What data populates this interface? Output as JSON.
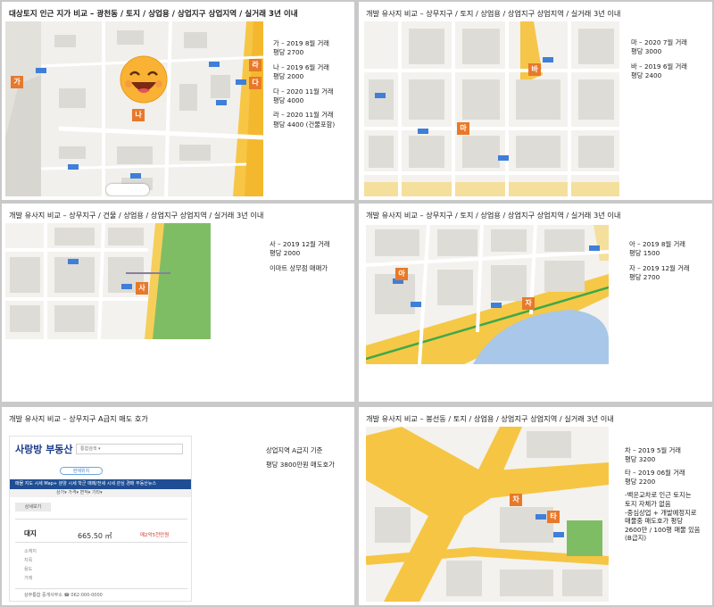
{
  "slides": [
    {
      "title": "대상토지 인근 지가 비교 – 광천동 / 토지 / 상업용 / 상업지구 상업지역 / 실거래 3년 이내",
      "markers": [
        "가",
        "나",
        "라",
        "다"
      ],
      "lines": [
        "가 – 2019 8월 거래",
        "평당 2700",
        "나 – 2019 6월 거래",
        "평당 2000",
        "다 – 2020 11월 거래",
        "평당 4000",
        "라 – 2020 11월 거래",
        "평당 4400 (건물포함)"
      ]
    },
    {
      "title": "개발 유사지 비교 – 상무지구 / 토지 / 상업용 / 상업지구 상업지역 / 실거래 3년 이내",
      "markers": [
        "바",
        "마"
      ],
      "lines": [
        "마 – 2020 7월 거래",
        "평당 3000",
        "바 – 2019 6월 거래",
        "평당 2400"
      ]
    },
    {
      "title": "개발 유사지 비교 – 상무지구 / 건물 / 상업용 / 상업지구 상업지역 / 실거래 3년 이내",
      "markers": [
        "사"
      ],
      "lines": [
        "사 – 2019 12월 거래",
        "평당 2000",
        "이마트 상무점 매매가"
      ]
    },
    {
      "title": "개발 유사지 비교 – 상무지구 / 토지 / 상업용 / 상업지구 상업지역 / 실거래 3년 이내",
      "markers": [
        "아",
        "자"
      ],
      "lines": [
        "아 – 2019 8월 거래",
        "평당 1500",
        "자 – 2019 12월 거래",
        "평당 2700"
      ]
    },
    {
      "title": "개발 유사지 비교 – 상무지구 A급지 매도 호가",
      "lines": [
        "상업지역  A급지 기준",
        "평당 3800만원 매도호가"
      ],
      "web": {
        "logo": "사랑방 부동산",
        "search_placeholder": "통합검색 ▾",
        "pill": "현재위치",
        "nav": "매물  지도  시세  Map+  분양  시세  학군  매매/전세 시세  관심  경매  부동산뉴스",
        "filter": "상가▾   가격▾   면적▾   기타▾",
        "sub": "상세보기",
        "card_kind": "대지",
        "card_area": "665.50 ㎡",
        "card_price": "매2억5천만원",
        "rows": [
          "소재지",
          "지목",
          "용도",
          "거래"
        ],
        "broker": "상무통합 중개사무소  ☎ 062-000-0000"
      }
    },
    {
      "title": "개발 유사지 비교 – 봉선동 / 토지 / 상업용 / 상업지구 상업지역 / 실거래 3년 이내",
      "markers": [
        "차",
        "타"
      ],
      "lines": [
        "차 – 2019 5월 거래",
        "평당 3200",
        "타 – 2019 06월 거래",
        "평당 2200",
        "-백운교차로 인근 토지는",
        "토지 자체가 없음",
        "-중심상업 + 개발예정지로",
        "매물중 매도호가 평당",
        "2600만 / 100평 매물 있음",
        "(B급지)"
      ]
    }
  ]
}
